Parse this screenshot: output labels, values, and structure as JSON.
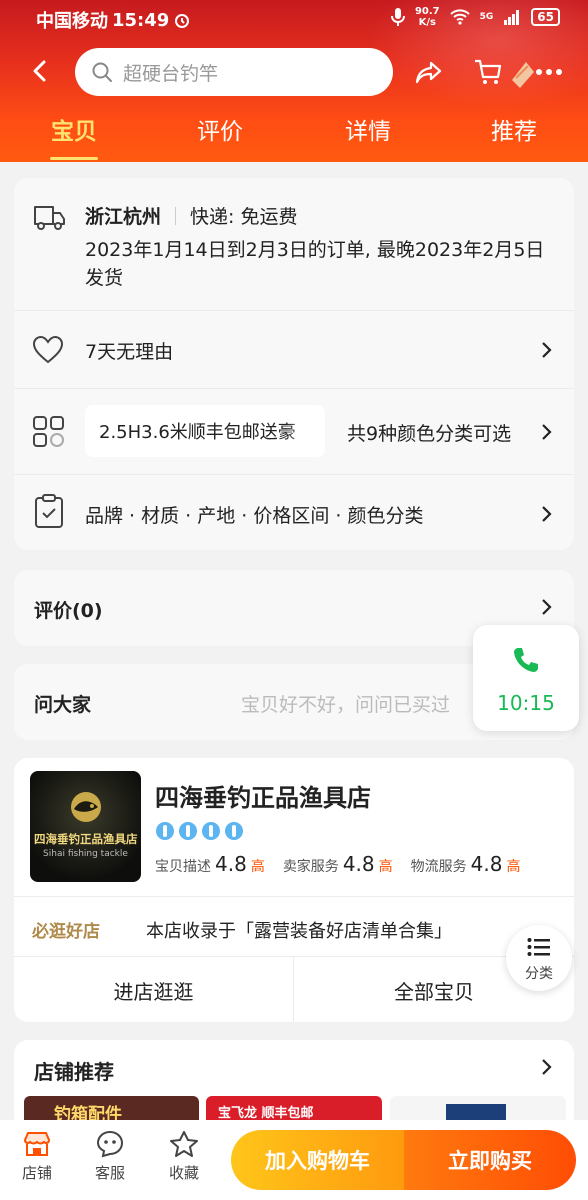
{
  "status_bar": {
    "carrier": "中国移动",
    "time": "15:49",
    "speed_value": "90.7",
    "speed_unit": "K/s",
    "network": "5G",
    "battery": "65"
  },
  "search": {
    "placeholder": "超硬台钓竿"
  },
  "tabs": [
    {
      "label": "宝贝",
      "active": true
    },
    {
      "label": "评价",
      "active": false
    },
    {
      "label": "详情",
      "active": false
    },
    {
      "label": "推荐",
      "active": false
    }
  ],
  "shipping": {
    "origin": "浙江杭州",
    "method": "快递: 免运费",
    "note": "2023年1月14日到2月3日的订单, 最晚2023年2月5日发货"
  },
  "returns": {
    "label": "7天无理由"
  },
  "sku": {
    "selected": "2.5H3.6米顺丰包邮送豪",
    "count_text": "共9种颜色分类可选"
  },
  "params": {
    "label": "品牌 · 材质 · 产地 · 价格区间 · 颜色分类"
  },
  "reviews": {
    "label": "评价(0)"
  },
  "ask": {
    "label": "问大家",
    "placeholder": "宝贝好不好，问问已买过"
  },
  "float_call": {
    "time": "10:15"
  },
  "shop": {
    "logo_text": "四海垂钓正品渔具店",
    "logo_sub": "Sihai fishing tackle",
    "name": "四海垂钓正品渔具店",
    "ratings": [
      {
        "label": "宝贝描述",
        "score": "4.8",
        "level": "高"
      },
      {
        "label": "卖家服务",
        "score": "4.8",
        "level": "高"
      },
      {
        "label": "物流服务",
        "score": "4.8",
        "level": "高"
      }
    ],
    "badge": "必逛好店",
    "collection": "本店收录于「露营装备好店清单合集」",
    "enter_label": "进店逛逛",
    "all_label": "全部宝贝"
  },
  "float_category": {
    "label": "分类"
  },
  "recommend": {
    "title": "店铺推荐",
    "thumbs": [
      {
        "text": "钓箱配件",
        "bg": "#5a2a22"
      },
      {
        "text": "宝飞龙 顺丰包邮",
        "bg": "#d91e2a"
      },
      {
        "text": "",
        "bg": "#f5f5f5"
      }
    ]
  },
  "bottom": {
    "store_label": "店铺",
    "service_label": "客服",
    "fav_label": "收藏",
    "cart_label": "加入购物车",
    "buy_label": "立即购买"
  },
  "colors": {
    "accent_orange": "#ff5000",
    "rating_high": "#ff5000",
    "green_call": "#19b955"
  }
}
